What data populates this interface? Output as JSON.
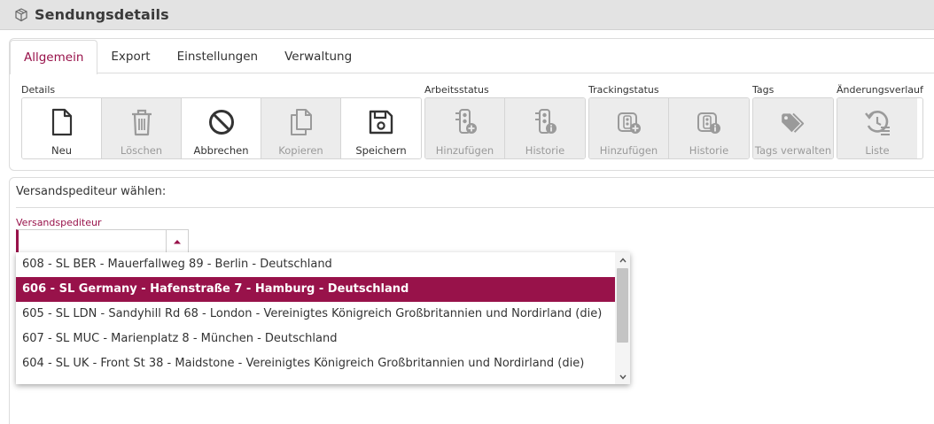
{
  "window": {
    "title": "Sendungsdetails",
    "icon": "package-icon"
  },
  "tabs": [
    {
      "label": "Allgemein",
      "active": true
    },
    {
      "label": "Export",
      "active": false
    },
    {
      "label": "Einstellungen",
      "active": false
    },
    {
      "label": "Verwaltung",
      "active": false
    }
  ],
  "toolbar": {
    "details": {
      "label": "Details",
      "buttons": [
        {
          "label": "Neu",
          "icon": "new-document-icon",
          "enabled": true
        },
        {
          "label": "Löschen",
          "icon": "trash-icon",
          "enabled": false
        },
        {
          "label": "Abbrechen",
          "icon": "cancel-icon",
          "enabled": true
        },
        {
          "label": "Kopieren",
          "icon": "copy-icon",
          "enabled": false
        },
        {
          "label": "Speichern",
          "icon": "save-icon",
          "enabled": true
        }
      ]
    },
    "arbeitsstatus": {
      "label": "Arbeitsstatus",
      "buttons": [
        {
          "label": "Hinzufügen",
          "icon": "traffic-light-add-icon",
          "enabled": false
        },
        {
          "label": "Historie",
          "icon": "traffic-light-info-icon",
          "enabled": false
        }
      ]
    },
    "trackingstatus": {
      "label": "Trackingstatus",
      "buttons": [
        {
          "label": "Hinzufügen",
          "icon": "tracking-light-add-icon",
          "enabled": false
        },
        {
          "label": "Historie",
          "icon": "tracking-light-info-icon",
          "enabled": false
        }
      ]
    },
    "tags": {
      "label": "Tags",
      "buttons": [
        {
          "label": "Tags verwalten",
          "icon": "tags-icon",
          "enabled": false
        }
      ]
    },
    "aenderungsverlauf": {
      "label": "Änderungsverlauf",
      "buttons": [
        {
          "label": "Liste",
          "icon": "history-list-icon",
          "enabled": false
        }
      ]
    }
  },
  "main": {
    "section_title": "Versandspediteur wählen:",
    "field_label": "Versandspediteur",
    "field_value": ""
  },
  "dropdown": {
    "options": [
      "608 - SL BER - Mauerfallweg 89 - Berlin - Deutschland",
      "606 - SL Germany - Hafenstraße 7 - Hamburg - Deutschland",
      "605 - SL LDN - Sandyhill Rd 68 - London - Vereinigtes Königreich Großbritannien und Nordirland (die)",
      "607 - SL MUC - Marienplatz 8 - München - Deutschland",
      "604 - SL UK - Front St 38 - Maidstone - Vereinigtes Königreich Großbritannien und Nordirland (die)"
    ],
    "selected_index": 1
  },
  "colors": {
    "accent": "#98124a",
    "titlebar_bg": "#e3e3e3",
    "disabled_bg": "#ececec",
    "disabled_icon": "#9a9a9a",
    "enabled_icon": "#333333"
  }
}
